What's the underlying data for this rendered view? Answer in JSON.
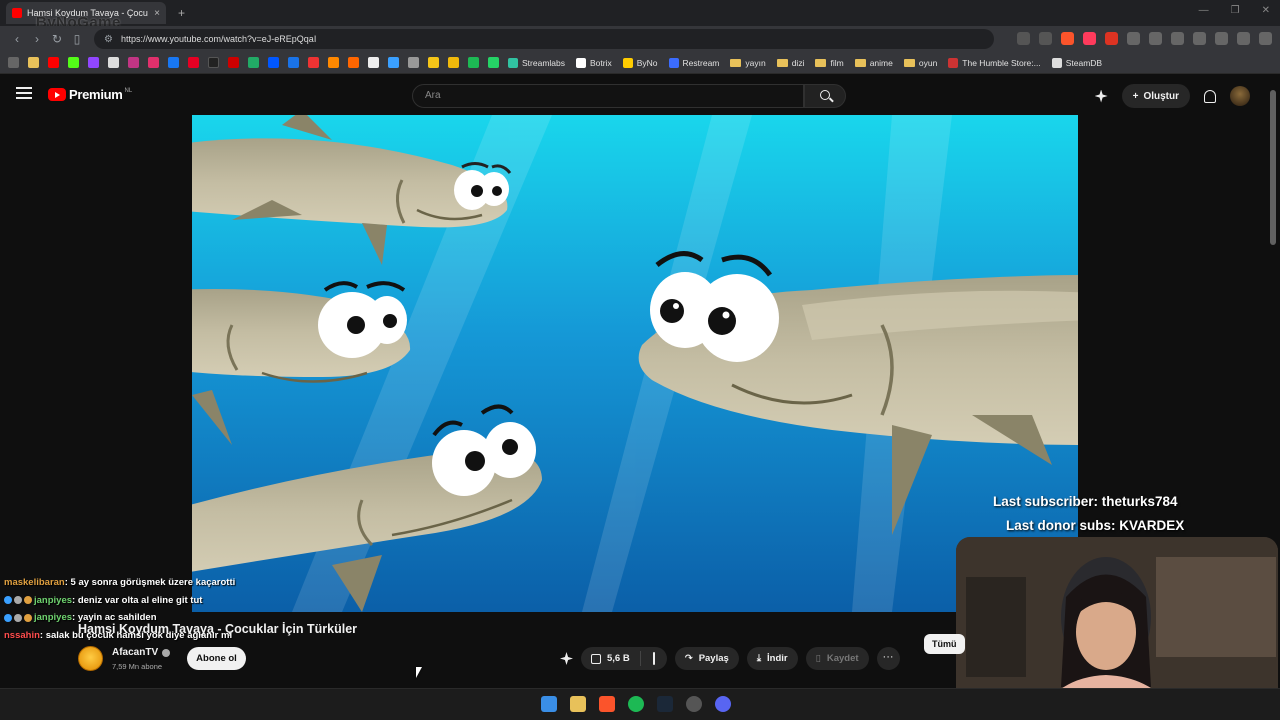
{
  "browser": {
    "tab_title": "Hamsi Koydum Tavaya - Çocu",
    "tab_close": "×",
    "new_tab": "+",
    "url": "https://www.youtube.com/watch?v=eJ-eREpQqaI",
    "overlay_logo": "ByNoGame"
  },
  "bookmarks": [
    {
      "label": "Streamlabs",
      "color": "#31c3a2"
    },
    {
      "label": "Botrix",
      "color": "#ffffff"
    },
    {
      "label": "ByNo",
      "color": "#ffcc00"
    },
    {
      "label": "Restream",
      "color": "#3b6cff"
    },
    {
      "label": "yayın",
      "folder": true
    },
    {
      "label": "dizi",
      "folder": true
    },
    {
      "label": "film",
      "folder": true
    },
    {
      "label": "anime",
      "folder": true
    },
    {
      "label": "oyun",
      "folder": true
    },
    {
      "label": "The Humble Store:...",
      "color": "#cc3333"
    },
    {
      "label": "SteamDB",
      "color": "#dddddd"
    }
  ],
  "youtube": {
    "logo_text": "Premium",
    "logo_region": "NL",
    "search_placeholder": "Ara",
    "create_label": "Oluştur"
  },
  "stream": {
    "last_subscriber": "Last subscriber: theturks784",
    "last_donor": "Last donor subs: KVARDEX"
  },
  "chat": [
    {
      "user": "maskelibaran",
      "message": ": 5 ay sonra görüşmek üzere kaçarotti"
    },
    {
      "user": "janpiyes",
      "message": ": deniz var olta al eline git tut"
    },
    {
      "user": "janpiyes",
      "message": ": yayin ac sahilden"
    },
    {
      "user": "nssahin",
      "message": ": salak bu çocuk hamsi yok diye ağlanır mı"
    }
  ],
  "video": {
    "title": "Hamsi Koydum Tavaya - Çocuklar İçin Türküler",
    "channel": "AfacanTV",
    "subscribers": "7,59 Mn abone",
    "subscribe_label": "Abone ol",
    "likes": "5,6 B",
    "share_label": "Paylaş",
    "download_label": "İndir",
    "save_label": "Kaydet",
    "more_label": "···",
    "filter_all": "Tümü"
  },
  "colors": {
    "yt_red": "#ff0000",
    "water_top": "#19d6ec",
    "water_bottom": "#0b5fa8",
    "fish_body": "#b9b297"
  }
}
